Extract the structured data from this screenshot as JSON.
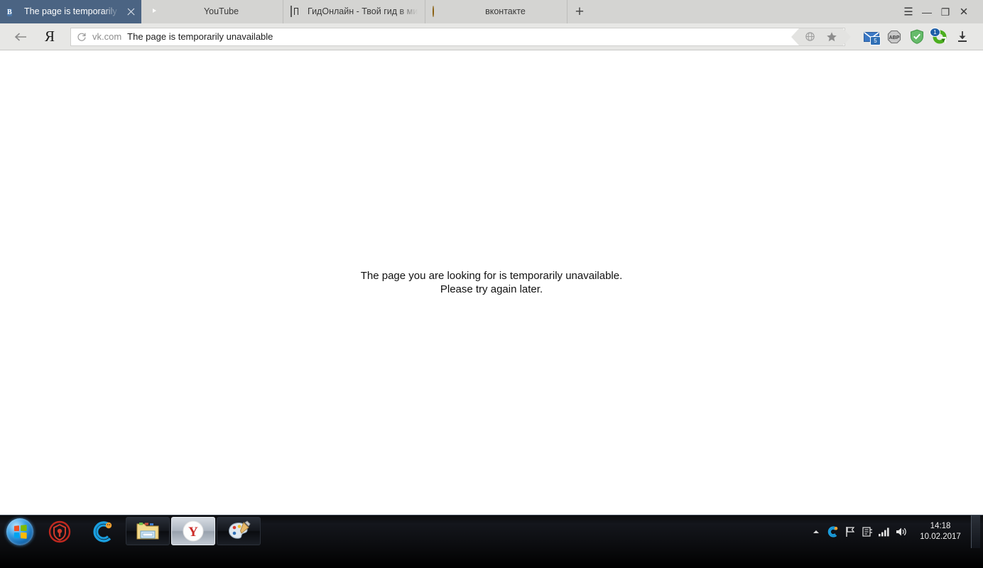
{
  "browser": {
    "tabs": [
      {
        "title": "The page is temporarily u",
        "favicon": "vk-icon",
        "active": true,
        "close_label": "×"
      },
      {
        "title": "YouTube",
        "favicon": "youtube-icon",
        "active": false,
        "close_label": ""
      },
      {
        "title": "ГидОнлайн - Твой гид в ми",
        "favicon": "gidonline-icon",
        "active": false,
        "close_label": ""
      },
      {
        "title": "вконтакте",
        "favicon": "vkontakte-icon",
        "active": false,
        "close_label": ""
      }
    ],
    "new_tab_label": "+",
    "window_controls": {
      "menu": "☰",
      "minimize": "—",
      "restore": "❐",
      "close": "✕"
    },
    "toolbar": {
      "back_label": "←",
      "yandex_label": "Я",
      "reload_label": "↻",
      "omnibox_host": "vk.com",
      "omnibox_title": "The page is temporarily unavailable",
      "turbo_label": "⊕",
      "bookmark_label": "★",
      "extensions": [
        {
          "name": "mail-extension",
          "badge": "5"
        },
        {
          "name": "adblock-plus-extension",
          "label": "ABP",
          "badge": ""
        },
        {
          "name": "shield-extension",
          "badge": ""
        },
        {
          "name": "yandex-protect-extension",
          "badge": "1"
        },
        {
          "name": "downloads-button",
          "badge": ""
        }
      ]
    }
  },
  "page": {
    "error_line_1": "The page you are looking for is temporarily unavailable.",
    "error_line_2": "Please try again later."
  },
  "taskbar": {
    "start_label": "Start",
    "quick_launch": [
      {
        "name": "security-app-icon"
      },
      {
        "name": "ccleaner-icon"
      }
    ],
    "buttons": [
      {
        "name": "windows-explorer",
        "active": false
      },
      {
        "name": "yandex-browser",
        "active": true
      },
      {
        "name": "paint",
        "active": false
      }
    ],
    "tray": {
      "show_hidden_label": "▲",
      "icons": [
        {
          "name": "ccleaner-tray-icon"
        },
        {
          "name": "action-center-flag-icon"
        },
        {
          "name": "device-tray-icon"
        },
        {
          "name": "network-signal-icon"
        },
        {
          "name": "volume-icon"
        }
      ],
      "time": "14:18",
      "date": "10.02.2017"
    }
  }
}
